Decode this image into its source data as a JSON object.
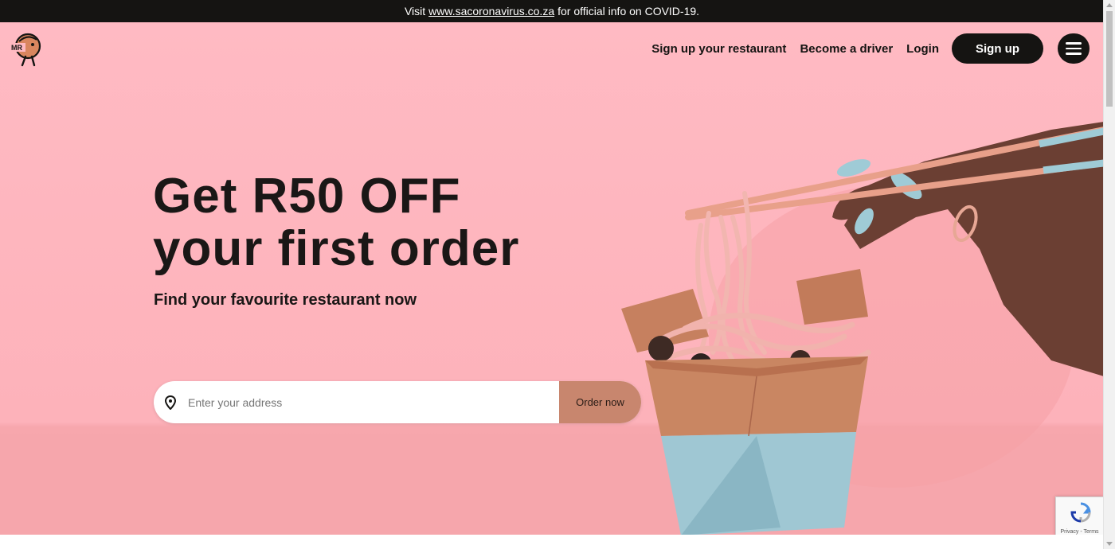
{
  "banner": {
    "prefix": "Visit",
    "link_text": "www.sacoronavirus.co.za",
    "suffix": "for official info on COVID-19."
  },
  "logo": {
    "text": "MR",
    "icon": "mr-d-mascot-logo"
  },
  "nav": {
    "signup_restaurant": "Sign up your restaurant",
    "become_driver": "Become a driver",
    "login": "Login",
    "signup": "Sign up",
    "menu_icon": "hamburger-menu-icon"
  },
  "hero": {
    "headline_line1": "Get R50 OFF",
    "headline_line2": "your first order",
    "subheadline": "Find your favourite restaurant now"
  },
  "search": {
    "placeholder": "Enter your address",
    "value": "",
    "button_label": "Order now",
    "icon": "location-pin-icon"
  },
  "recaptcha": {
    "label": "Privacy - Terms"
  },
  "colors": {
    "background": "#ffb9c1",
    "dark": "#151412",
    "order_button": "#c8866e",
    "box_blue": "#9fc7d3"
  }
}
